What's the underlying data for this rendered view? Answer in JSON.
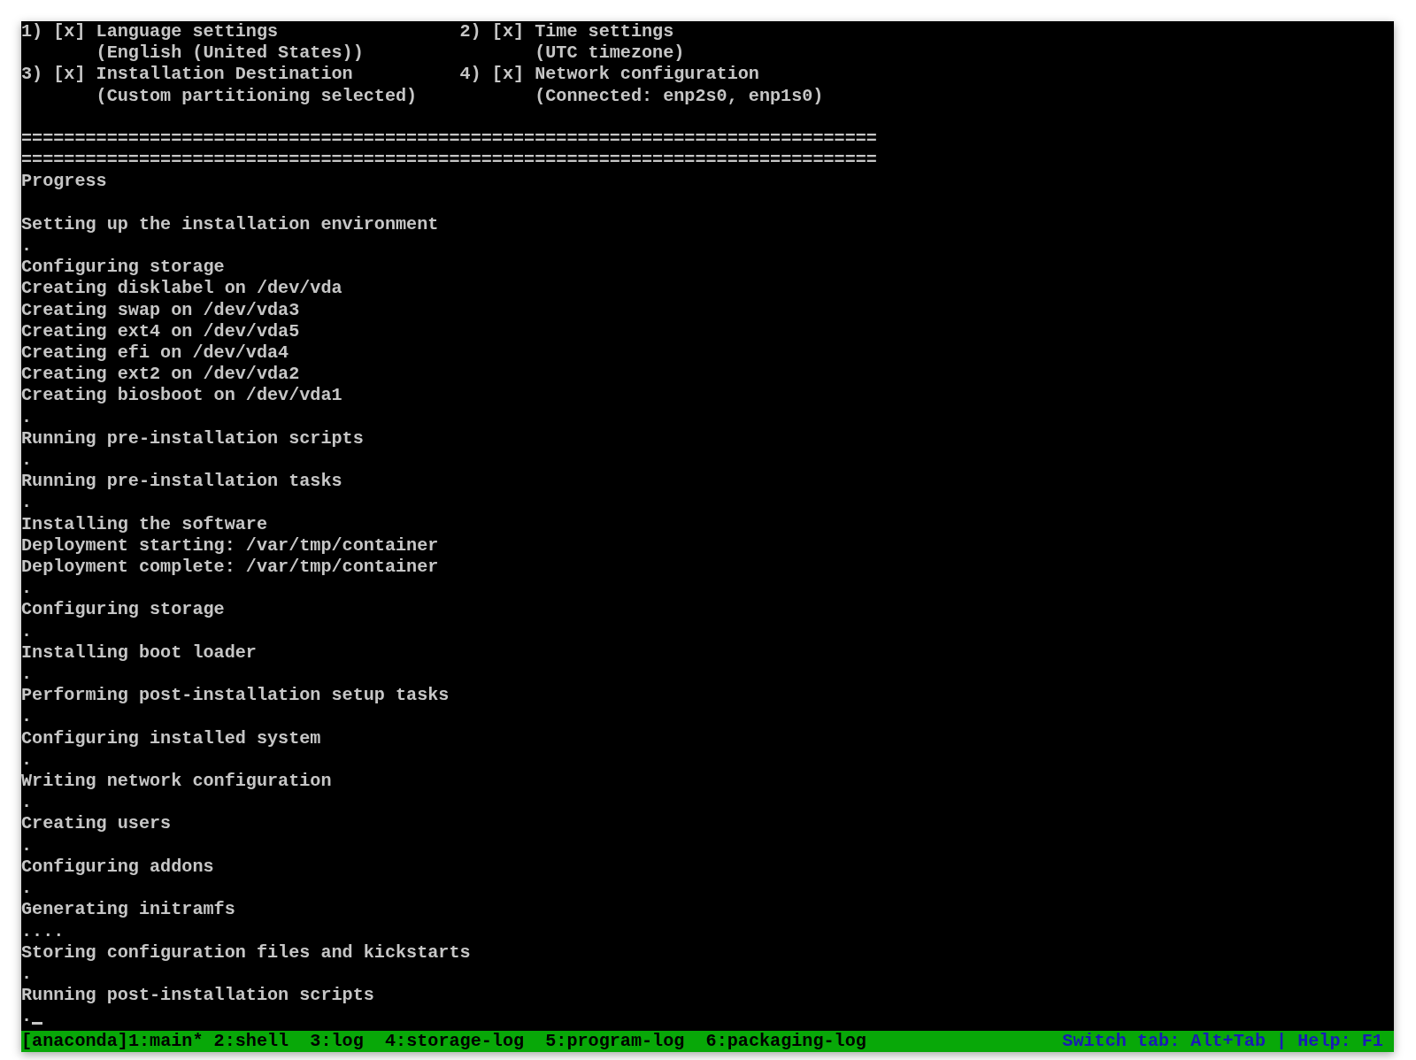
{
  "hub": {
    "spokes": [
      {
        "number": "1)",
        "checkbox": "[x]",
        "checked": true,
        "title": "Language settings",
        "status": "(English (United States))"
      },
      {
        "number": "2)",
        "checkbox": "[x]",
        "checked": true,
        "title": "Time settings",
        "status": "(UTC timezone)"
      },
      {
        "number": "3)",
        "checkbox": "[x]",
        "checked": true,
        "title": "Installation Destination",
        "status": "(Custom partitioning selected)"
      },
      {
        "number": "4)",
        "checkbox": "[x]",
        "checked": true,
        "title": "Network configuration",
        "status": "(Connected: enp2s0, enp1s0)"
      }
    ],
    "separators": [
      "================================================================================",
      "================================================================================"
    ]
  },
  "progress": {
    "title": "Progress",
    "lines": [
      {
        "text": "Setting up the installation environment"
      },
      {
        "text": "."
      },
      {
        "text": "Configuring storage"
      },
      {
        "text": "Creating disklabel on /dev/vda"
      },
      {
        "text": "Creating swap on /dev/vda3"
      },
      {
        "text": "Creating ext4 on /dev/vda5"
      },
      {
        "text": "Creating efi on /dev/vda4"
      },
      {
        "text": "Creating ext2 on /dev/vda2"
      },
      {
        "text": "Creating biosboot on /dev/vda1"
      },
      {
        "text": "."
      },
      {
        "text": "Running pre-installation scripts"
      },
      {
        "text": "."
      },
      {
        "text": "Running pre-installation tasks"
      },
      {
        "text": "."
      },
      {
        "text": "Installing the software"
      },
      {
        "text": "Deployment starting: /var/tmp/container"
      },
      {
        "text": "Deployment complete: /var/tmp/container"
      },
      {
        "text": "."
      },
      {
        "text": "Configuring storage"
      },
      {
        "text": "."
      },
      {
        "text": "Installing boot loader"
      },
      {
        "text": "."
      },
      {
        "text": "Performing post-installation setup tasks"
      },
      {
        "text": "."
      },
      {
        "text": "Configuring installed system"
      },
      {
        "text": "."
      },
      {
        "text": "Writing network configuration"
      },
      {
        "text": "."
      },
      {
        "text": "Creating users"
      },
      {
        "text": "."
      },
      {
        "text": "Configuring addons"
      },
      {
        "text": "."
      },
      {
        "text": "Generating initramfs"
      },
      {
        "text": "...."
      },
      {
        "text": "Storing configuration files and kickstarts"
      },
      {
        "text": "."
      },
      {
        "text": "Running post-installation scripts"
      },
      {
        "text": "."
      }
    ]
  },
  "status_bar": {
    "session": "[anaconda]",
    "tabs": [
      {
        "label": "1:main*"
      },
      {
        "label": "2:shell"
      },
      {
        "label": "3:log"
      },
      {
        "label": "4:storage-log"
      },
      {
        "label": "5:program-log"
      },
      {
        "label": "6:packaging-log"
      }
    ],
    "hint": "Switch tab: Alt+Tab | Help: F1"
  }
}
